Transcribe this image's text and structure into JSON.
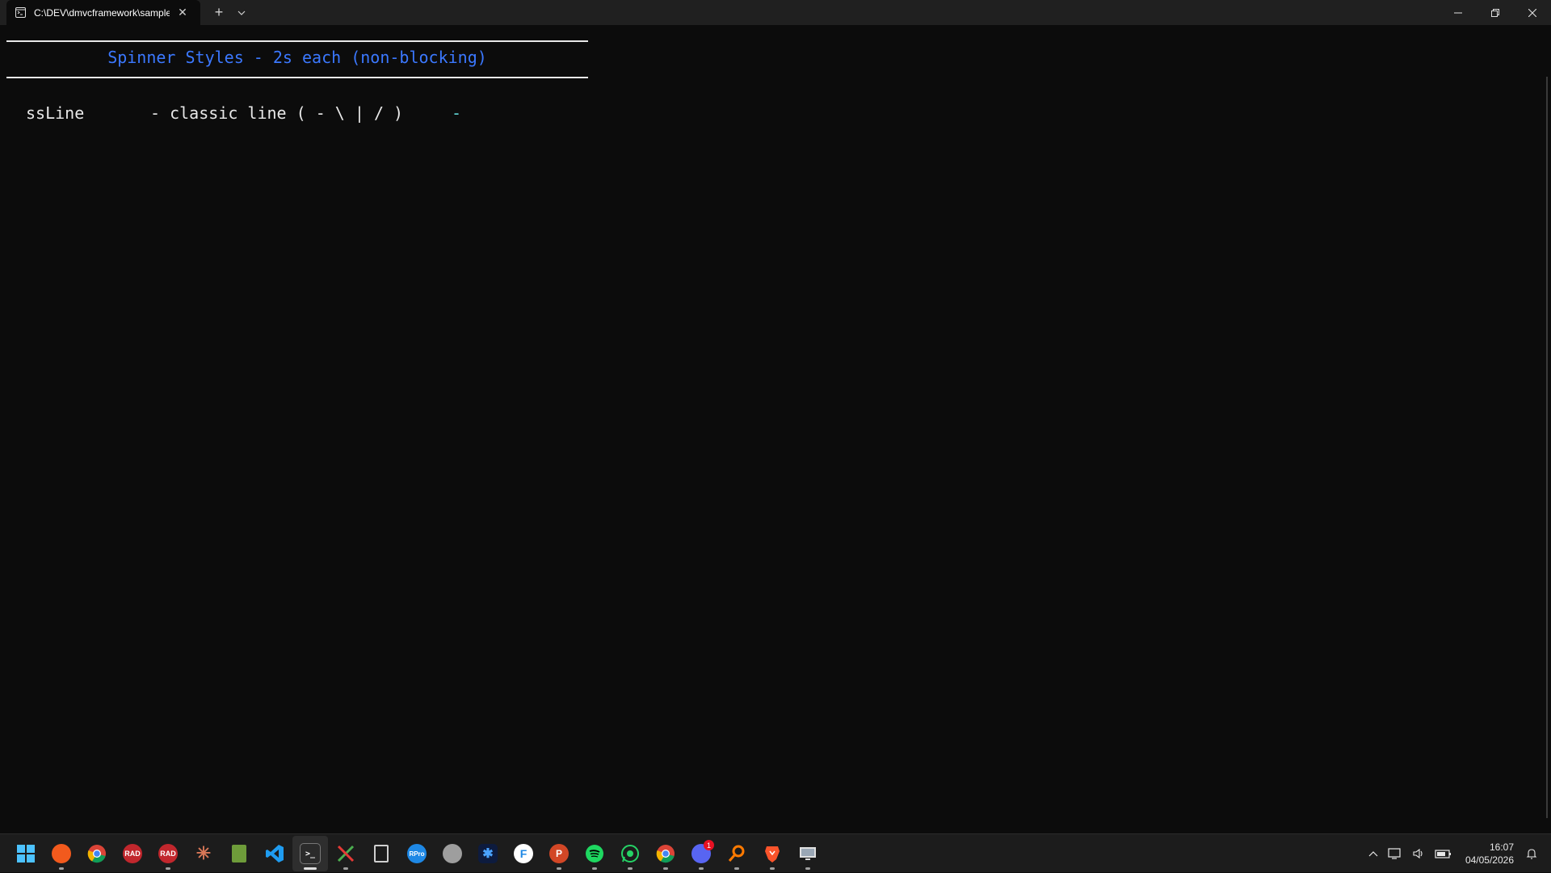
{
  "window": {
    "tab_title": "C:\\DEV\\dmvcframework\\samples\\console_spinners",
    "tab_close": "✕",
    "new_tab": "+",
    "dropdown": "⌄"
  },
  "terminal": {
    "heading": "Spinner Styles - 2s each (non-blocking)",
    "style_name": "ssLine",
    "style_desc": "- classic line ( - \\ | / )",
    "spinner_frame": "-",
    "colors": {
      "heading": "#3b78ff",
      "text": "#e8e8e8",
      "spinner": "#61d6d6"
    }
  },
  "taskbar": {
    "apps": [
      {
        "name": "start-icon",
        "label": ""
      },
      {
        "name": "browser-icon",
        "label": ""
      },
      {
        "name": "chrome-icon",
        "label": ""
      },
      {
        "name": "rad-studio-icon",
        "label": "RAD"
      },
      {
        "name": "rad-studio-icon",
        "label": "RAD"
      },
      {
        "name": "claude-icon",
        "label": "✳"
      },
      {
        "name": "notepad-icon",
        "label": ""
      },
      {
        "name": "vscode-icon",
        "label": ""
      },
      {
        "name": "terminal-icon",
        "label": ">_"
      },
      {
        "name": "tools-icon",
        "label": ""
      },
      {
        "name": "clipboard-icon",
        "label": ""
      },
      {
        "name": "rpro-icon",
        "label": "RPro"
      },
      {
        "name": "user-icon",
        "label": ""
      },
      {
        "name": "app-icon",
        "label": ""
      },
      {
        "name": "f-app-icon",
        "label": "F"
      },
      {
        "name": "powerpoint-icon",
        "label": "P"
      },
      {
        "name": "spotify-icon",
        "label": ""
      },
      {
        "name": "whatsapp-icon",
        "label": ""
      },
      {
        "name": "chrome-icon",
        "label": ""
      },
      {
        "name": "discord-icon",
        "label": ""
      },
      {
        "name": "search-app-icon",
        "label": ""
      },
      {
        "name": "brave-icon",
        "label": ""
      },
      {
        "name": "remote-desktop-icon",
        "label": ""
      }
    ],
    "discord_badge": "1",
    "time": "16:07",
    "date": "04/05/2026"
  }
}
